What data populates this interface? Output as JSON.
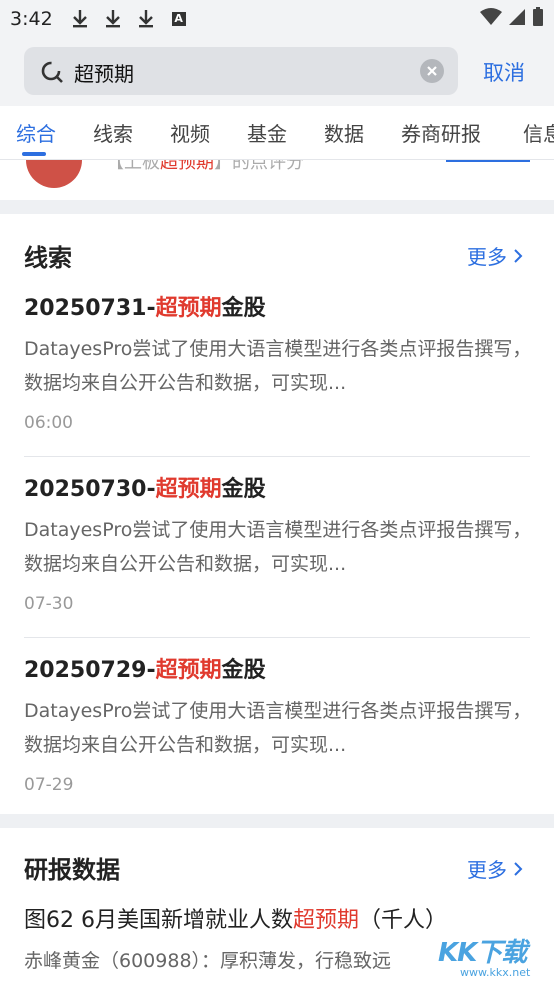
{
  "status_bar": {
    "time": "3:42",
    "icons": [
      "download-icon",
      "download-icon",
      "download-icon",
      "a-icon",
      "wifi-icon",
      "signal-icon",
      "battery-icon"
    ]
  },
  "search": {
    "query": "超预期",
    "cancel_label": "取消"
  },
  "tabs": [
    {
      "label": "综合",
      "active": true
    },
    {
      "label": "线索",
      "active": false
    },
    {
      "label": "视频",
      "active": false
    },
    {
      "label": "基金",
      "active": false
    },
    {
      "label": "数据",
      "active": false
    },
    {
      "label": "券商研报",
      "active": false
    },
    {
      "label": "信息",
      "active": false
    }
  ],
  "partial_row": {
    "text_prefix": "【上板",
    "text_highlight": "超预期",
    "text_suffix": "】的点评分"
  },
  "clues": {
    "title": "线索",
    "more_label": "更多",
    "items": [
      {
        "title_prefix": "20250731-",
        "title_highlight": "超预期",
        "title_suffix": "金股",
        "summary": "DatayesPro尝试了使用大语言模型进行各类点评报告撰写，数据均来自公开公告和数据，可实现...",
        "time": "06:00"
      },
      {
        "title_prefix": "20250730-",
        "title_highlight": "超预期",
        "title_suffix": "金股",
        "summary": "DatayesPro尝试了使用大语言模型进行各类点评报告撰写，数据均来自公开公告和数据，可实现...",
        "time": "07-30"
      },
      {
        "title_prefix": "20250729-",
        "title_highlight": "超预期",
        "title_suffix": "金股",
        "summary": "DatayesPro尝试了使用大语言模型进行各类点评报告撰写，数据均来自公开公告和数据，可实现...",
        "time": "07-29"
      }
    ]
  },
  "reports": {
    "title": "研报数据",
    "more_label": "更多",
    "item": {
      "title_prefix": "图62 6月美国新增就业人数",
      "title_highlight": "超预期",
      "title_suffix": "（千人）",
      "subtitle": "赤峰黄金（600988）：厚积薄发，行稳致远"
    }
  },
  "watermark": {
    "text": "KK下载",
    "url": "www.kkx.net"
  },
  "colors": {
    "accent": "#2d6fe0",
    "highlight": "#e03a2e",
    "background": "#eef0f3"
  }
}
